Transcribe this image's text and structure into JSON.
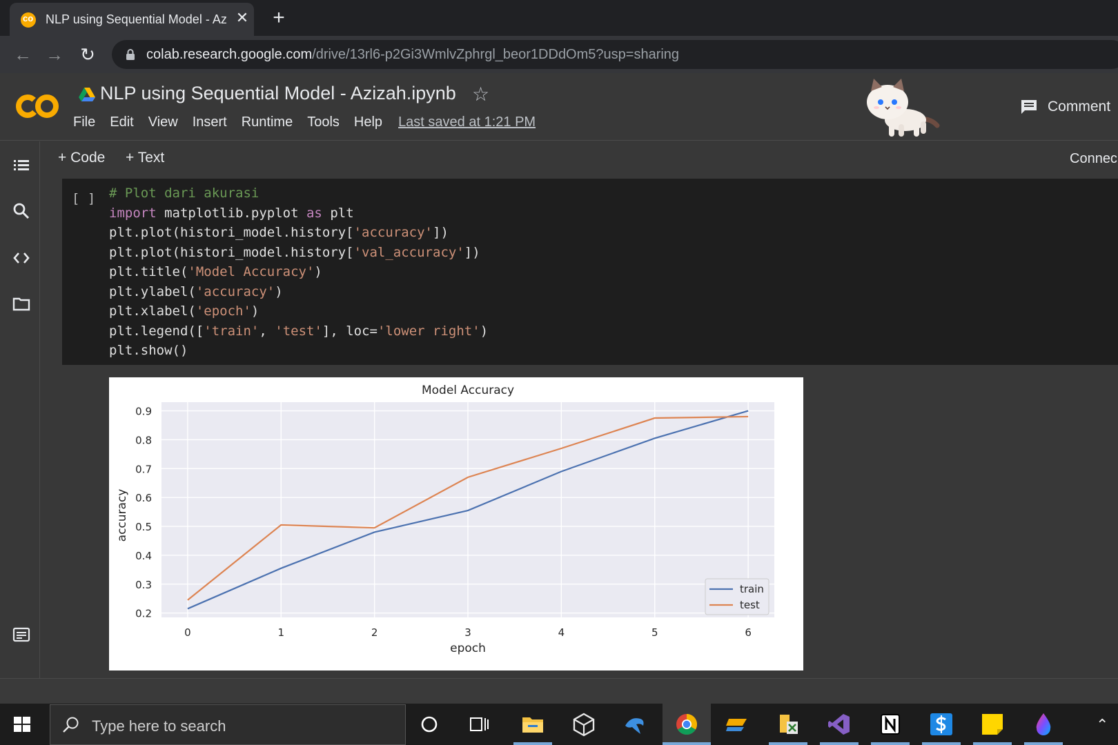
{
  "browser": {
    "tab_title": "NLP using Sequential Model - Az",
    "tab_close": "✕",
    "new_tab": "+",
    "url_host": "colab.research.google.com",
    "url_path": "/drive/13rl6-p2Gi3WmlvZphrgl_beor1DDdOm5?usp=sharing"
  },
  "colab": {
    "notebook_title": "NLP using Sequential Model - Azizah.ipynb",
    "menu": [
      "File",
      "Edit",
      "View",
      "Insert",
      "Runtime",
      "Tools",
      "Help"
    ],
    "last_saved": "Last saved at 1:21 PM",
    "comment_label": "Comment",
    "add_code": "+ Code",
    "add_text": "+ Text",
    "connect_label": "Connec"
  },
  "cell": {
    "run_indicator": "[ ]",
    "code": [
      [
        [
          "c-com",
          "# Plot dari akurasi"
        ]
      ],
      [
        [
          "c-kw",
          "import"
        ],
        [
          "",
          " matplotlib.pyplot "
        ],
        [
          "c-kw",
          "as"
        ],
        [
          "",
          " plt"
        ]
      ],
      [
        [
          "",
          "plt.plot(histori_model.history["
        ],
        [
          "c-str",
          "'accuracy'"
        ],
        [
          "",
          "])"
        ]
      ],
      [
        [
          "",
          "plt.plot(histori_model.history["
        ],
        [
          "c-str",
          "'val_accuracy'"
        ],
        [
          "",
          "])"
        ]
      ],
      [
        [
          "",
          "plt.title("
        ],
        [
          "c-str",
          "'Model Accuracy'"
        ],
        [
          "",
          ")"
        ]
      ],
      [
        [
          "",
          "plt.ylabel("
        ],
        [
          "c-str",
          "'accuracy'"
        ],
        [
          "",
          ")"
        ]
      ],
      [
        [
          "",
          "plt.xlabel("
        ],
        [
          "c-str",
          "'epoch'"
        ],
        [
          "",
          ")"
        ]
      ],
      [
        [
          "",
          "plt.legend(["
        ],
        [
          "c-str",
          "'train'"
        ],
        [
          "",
          ", "
        ],
        [
          "c-str",
          "'test'"
        ],
        [
          "",
          "], loc="
        ],
        [
          "c-str",
          "'lower right'"
        ],
        [
          "",
          ")"
        ]
      ],
      [
        [
          "",
          "plt.show()"
        ]
      ]
    ]
  },
  "chart_data": {
    "type": "line",
    "title": "Model Accuracy",
    "xlabel": "epoch",
    "ylabel": "accuracy",
    "x": [
      0,
      1,
      2,
      3,
      4,
      5,
      6
    ],
    "xlim": [
      -0.28,
      6.28
    ],
    "ylim": [
      0.185,
      0.93
    ],
    "yticks": [
      0.2,
      0.3,
      0.4,
      0.5,
      0.6,
      0.7,
      0.8,
      0.9
    ],
    "xticks": [
      0,
      1,
      2,
      3,
      4,
      5,
      6
    ],
    "grid": true,
    "legend_position": "lower right",
    "series": [
      {
        "name": "train",
        "color": "#4c72b0",
        "values": [
          0.215,
          0.355,
          0.48,
          0.555,
          0.69,
          0.805,
          0.9
        ]
      },
      {
        "name": "test",
        "color": "#dd8452",
        "values": [
          0.245,
          0.505,
          0.495,
          0.67,
          0.77,
          0.875,
          0.88
        ]
      }
    ]
  },
  "taskbar": {
    "search_placeholder": "Type here to search"
  }
}
